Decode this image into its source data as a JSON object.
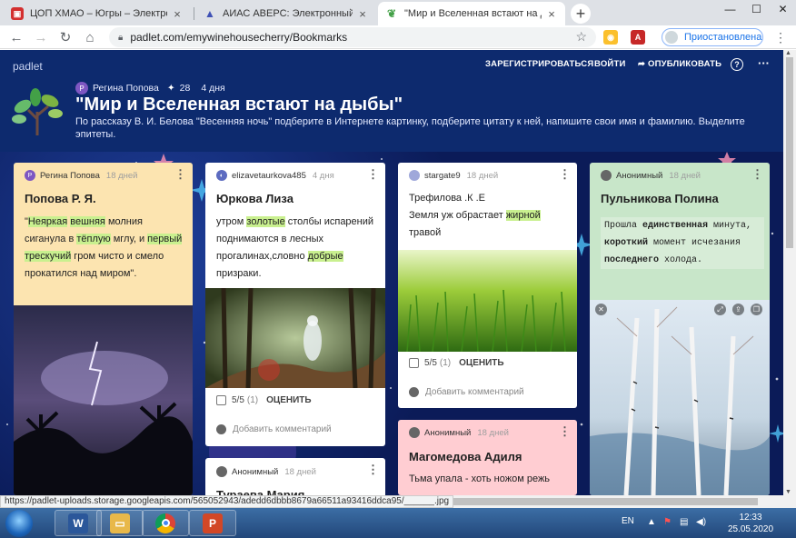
{
  "browser": {
    "tabs": [
      {
        "title": "ЦОП ХМАО – Югры – Электрон",
        "icon": "red-square-icon"
      },
      {
        "title": "АИАС АВЕРС: Электронный Кла",
        "icon": "triangle-logo-icon"
      },
      {
        "title": "\"Мир и Вселенная встают на ды",
        "icon": "padlet-leaf-icon"
      }
    ],
    "url": "padlet.com/emywinehousecherry/Bookmarks",
    "profile_status": "Приостановлена"
  },
  "padlet": {
    "logo": "padlet",
    "nav": {
      "register": "ЗАРЕГИСТРИРОВАТЬСЯ",
      "login": "ВОЙТИ",
      "publish": "ОПУБЛИКОВАТЬ"
    },
    "author": "Регина Попова",
    "author_initial": "Р",
    "likes": "28",
    "age": "4 дня",
    "title": "\"Мир и Вселенная встают на дыбы\"",
    "description": "По рассказу В. И. Белова \"Весенняя ночь\" подберите в Интернете картинку, подберите цитату к ней, напишите свои имя и фамилию. Выделите эпитеты."
  },
  "cards": [
    {
      "author": "Регина Попова",
      "author_initial": "Р",
      "time": "18 дней",
      "title": "Попова Р. Я.",
      "text": {
        "q1": "\"",
        "e1": "Неяркая",
        "sp1": " ",
        "e2": "вешняя",
        "t1": " молния сиганула в ",
        "e3": "тёплую",
        "t2": " мглу, и ",
        "e4": "первый трескучий",
        "t3": " гром чисто и смело прокатился над миром\"."
      },
      "image": "night-storm-image"
    },
    {
      "author": "elizavetaurkova485",
      "time": "4 дня",
      "title": "Юркова Лиза",
      "text": {
        "t0": "утром ",
        "e1": "золотые",
        "t1": " столбы испарений поднимаются в лесных прогалинах,словно ",
        "e2": "добрые",
        "t2": " призраки."
      },
      "image": "forest-ghost-image",
      "rating": "5/5",
      "rating_count": "(1)",
      "rate_label": "ОЦЕНИТЬ",
      "comment_placeholder": "Добавить комментарий"
    },
    {
      "author": "stargate9",
      "time": "18 дней",
      "subtitle": "Трефилова .К .Е",
      "text": {
        "t0": "Земля уж обрастает ",
        "e1": "жирной",
        "t1": " травой"
      },
      "image": "green-grass-image",
      "rating": "5/5",
      "rating_count": "(1)",
      "rate_label": "ОЦЕНИТЬ",
      "comment_placeholder": "Добавить комментарий"
    },
    {
      "author": "Анонимный",
      "time": "18 дней",
      "title": "Пульникова Полина",
      "text": {
        "t0": "Прошла ",
        "e1": "единственная",
        "t1": " минута, ",
        "e2": "короткий",
        "t2": " момент исчезания ",
        "e3": "последнего",
        "t3": " холода."
      },
      "image": "spring-birches-image"
    },
    {
      "author": "Анонимный",
      "time": "18 дней",
      "title": "Магомедова Адиля",
      "text": "Тьма упала - хоть ножом режь"
    },
    {
      "author": "Анонимный",
      "time": "18 дней",
      "title": "Тураева Мария"
    }
  ],
  "status_url": "https://padlet-uploads.storage.googleapis.com/565052943/adedd6dbbb8679a66511a93416ddca95/______.jpg",
  "taskbar": {
    "lang": "EN",
    "time": "12:33",
    "date": "25.05.2020"
  },
  "colors": {
    "header": "#0d2a6e",
    "card1": "#fce4b0",
    "card4": "#c8e6c9",
    "card5": "#ffcdd2",
    "highlight": "#c9f08f",
    "fab": "#ff4081"
  }
}
